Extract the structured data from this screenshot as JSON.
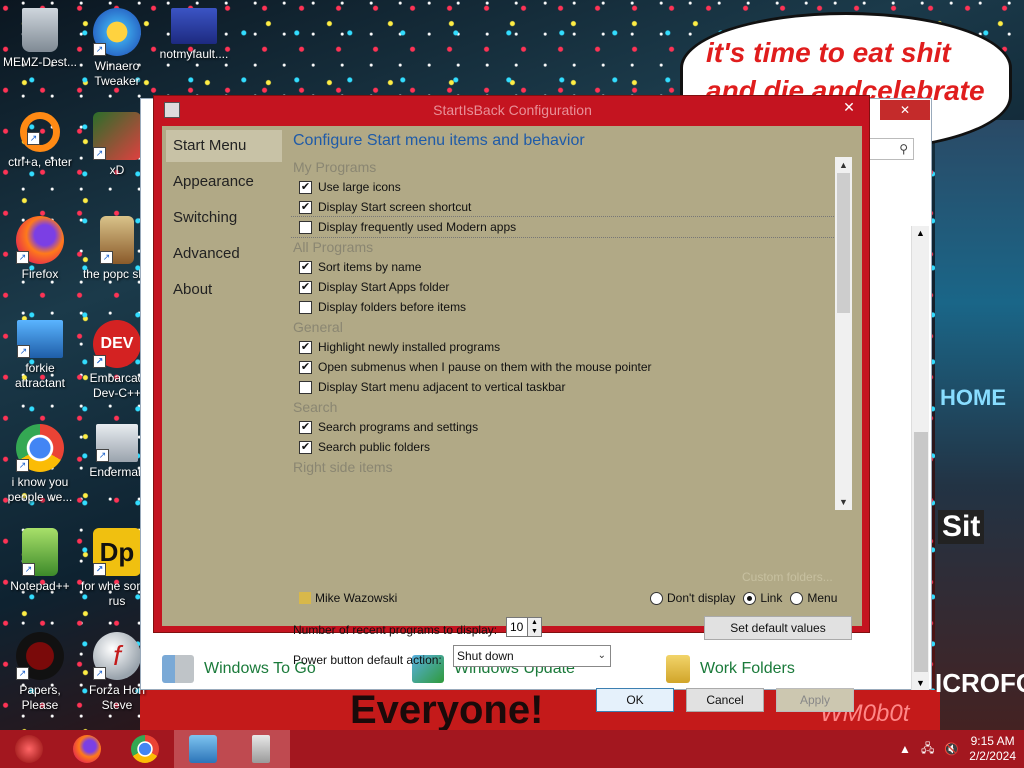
{
  "wallpaper": {
    "bubble_text": "it's time to eat shit and die andcelebrate",
    "bottom_text": "Everyone!",
    "watermark": "WM0b0t",
    "sign_1": "HOME",
    "sign_2": "Sit",
    "sign_3": "ICROFOS"
  },
  "desktop_icons": [
    {
      "label": "MEMZ-Dest...",
      "icon": "recycle-bin-icon"
    },
    {
      "label": "Winaero Tweaker",
      "icon": "winaero-icon"
    },
    {
      "label": "notmyfault....",
      "icon": "notmyfault-icon"
    },
    {
      "label": "ctrl+a, enter",
      "icon": "ring-icon"
    },
    {
      "label": "xD",
      "icon": "xd-icon"
    },
    {
      "label": "Firefox",
      "icon": "firefox-icon"
    },
    {
      "label": "the popc shit",
      "icon": "popcorn-icon"
    },
    {
      "label": "forkie attractant",
      "icon": "monitor-gear-icon"
    },
    {
      "label": "Embarcad Dev-C++",
      "icon": "devcpp-icon"
    },
    {
      "label": "i know you people we...",
      "icon": "chrome-icon"
    },
    {
      "label": "Enderman",
      "icon": "enderman-icon"
    },
    {
      "label": "Notepad++",
      "icon": "notepadpp-icon"
    },
    {
      "label": "for whe some rus",
      "icon": "dp-icon"
    },
    {
      "label": "Papers, Please",
      "icon": "papers-please-icon"
    },
    {
      "label": "Forza Hori Steve",
      "icon": "flash-icon"
    }
  ],
  "background_window": {
    "links": [
      {
        "label": "Windows To Go",
        "icon": "windows-to-go-icon"
      },
      {
        "label": "Windows Update",
        "icon": "windows-update-icon"
      },
      {
        "label": "Work Folders",
        "icon": "work-folders-icon"
      }
    ]
  },
  "dialog": {
    "title": "StartIsBack Configuration",
    "close_label": "✕",
    "nav": [
      "Start Menu",
      "Appearance",
      "Switching",
      "Advanced",
      "About"
    ],
    "heading": "Configure Start menu items and behavior",
    "sections": [
      {
        "title": "My Programs",
        "items": [
          {
            "label": "Use large icons",
            "checked": true
          },
          {
            "label": "Display Start screen shortcut",
            "checked": true
          },
          {
            "label": "Display frequently used Modern apps",
            "checked": false
          }
        ]
      },
      {
        "title": "All Programs",
        "items": [
          {
            "label": "Sort items by name",
            "checked": true
          },
          {
            "label": "Display Start Apps folder",
            "checked": true
          },
          {
            "label": "Display folders before items",
            "checked": false
          }
        ]
      },
      {
        "title": "General",
        "items": [
          {
            "label": "Highlight newly installed programs",
            "checked": true
          },
          {
            "label": "Open submenus when I pause on them with the mouse pointer",
            "checked": true
          },
          {
            "label": "Display Start menu adjacent to vertical taskbar",
            "checked": false
          }
        ]
      },
      {
        "title": "Search",
        "items": [
          {
            "label": "Search programs and settings",
            "checked": true
          },
          {
            "label": "Search public folders",
            "checked": true
          }
        ]
      },
      {
        "title": "Right side items",
        "items": []
      }
    ],
    "custom_folders": "Custom folders...",
    "right_item": {
      "label": "Mike Wazowski",
      "options": [
        "Don't display",
        "Link",
        "Menu"
      ],
      "selected": "Link"
    },
    "recent_label": "Number of recent programs to display:",
    "recent_value": "10",
    "set_default_label": "Set default values",
    "power_label": "Power button default action:",
    "power_value": "Shut down",
    "ok_label": "OK",
    "cancel_label": "Cancel",
    "apply_label": "Apply"
  },
  "taskbar": {
    "items": [
      "start-orb-icon",
      "firefox-icon",
      "chrome-icon",
      "control-panel-icon",
      "startisback-icon"
    ],
    "time": "9:15 AM",
    "date": "2/2/2024"
  }
}
